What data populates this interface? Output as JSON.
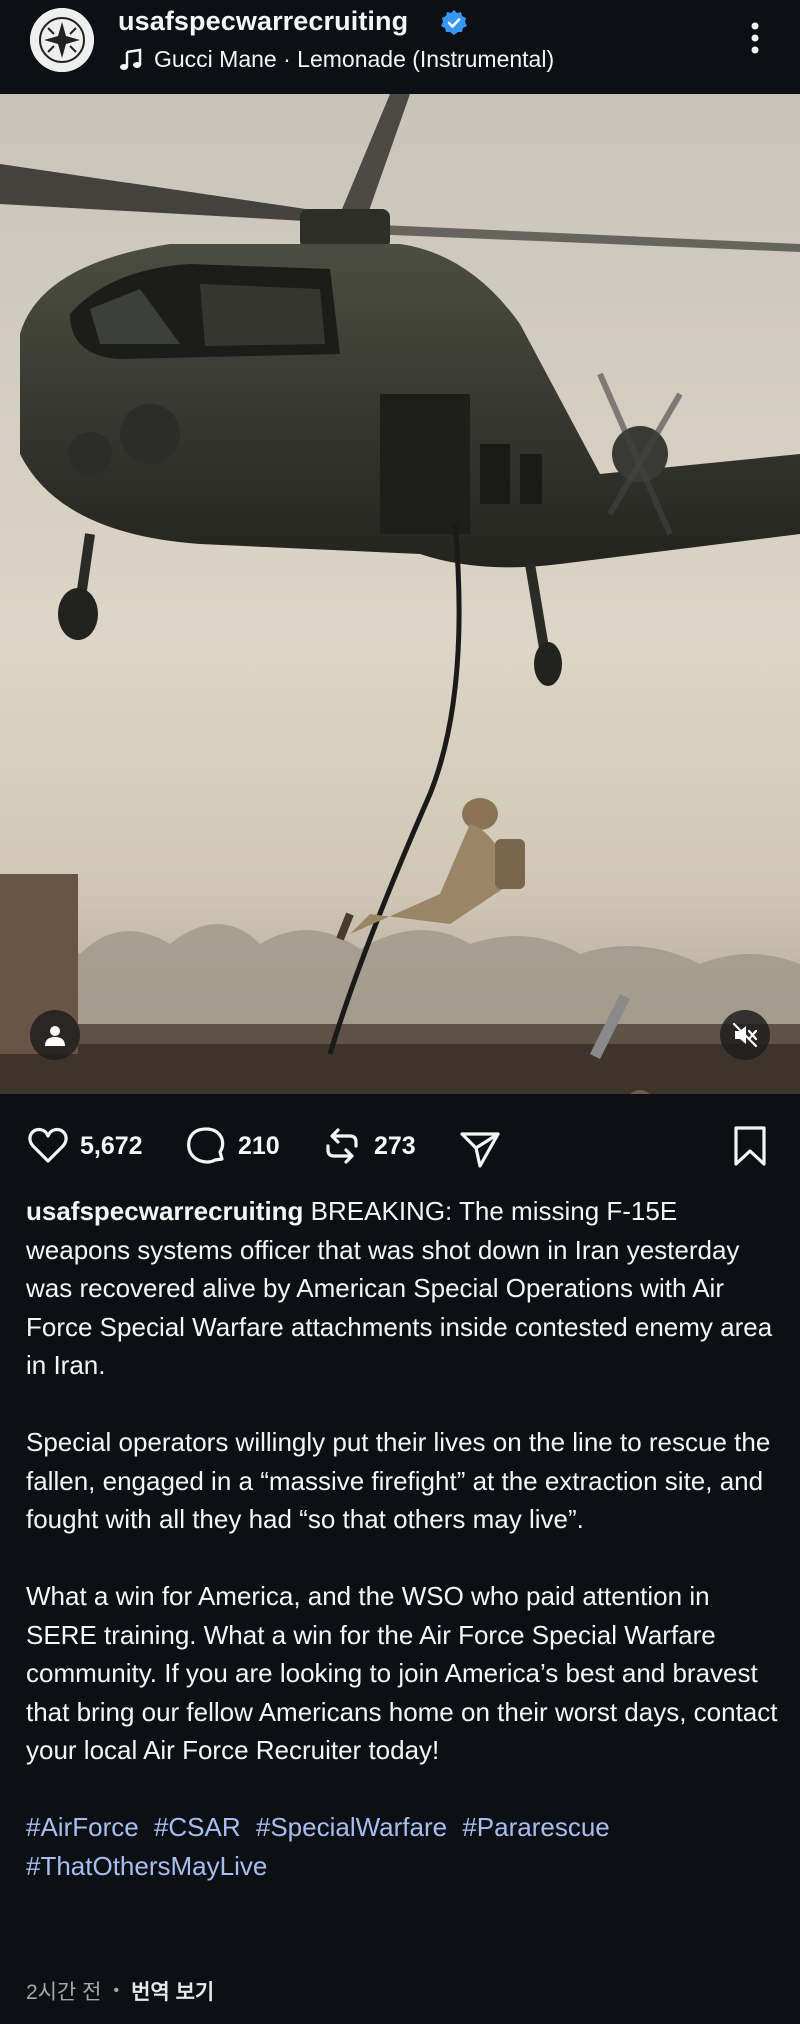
{
  "header": {
    "username": "usafspecwarrecruiting",
    "music": "Gucci Mane · Lemonade (Instrumental)"
  },
  "actions": {
    "likes": "5,672",
    "comments": "210",
    "reposts": "273"
  },
  "caption": {
    "username": "usafspecwarrecruiting",
    "paragraph1": "BREAKING: The missing F-15E weapons systems officer that was shot down in Iran yesterday was recovered alive by American Special Operations with Air Force Special Warfare attachments inside contested enemy area in Iran.",
    "paragraph2": "Special operators willingly put their lives on the line to rescue the fallen, engaged in a “massive firefight” at the extraction site, and fought with all they had “so that others may live”.",
    "paragraph3": "What a win for America, and the WSO who paid attention in SERE training. What a win for the Air Force Special Warfare community. If you are looking to join America’s best and bravest that bring our fellow Americans home on their worst days, contact your local Air Force Recruiter today!",
    "hashtags": [
      "#AirForce",
      "#CSAR",
      "#SpecialWarfare",
      "#Pararescue",
      "#ThatOthersMayLive"
    ]
  },
  "meta": {
    "time": "2시간 전",
    "separator": "•",
    "translate": "번역 보기"
  },
  "colors": {
    "background": "#0c1014",
    "text": "#f5f5f5",
    "hashtag": "#a8bdf0",
    "verified": "#3897f0",
    "muted": "#a8a8a8"
  },
  "icons": [
    "more-options-icon",
    "verified-badge-icon",
    "music-note-icon",
    "user-tag-icon",
    "mute-icon",
    "heart-icon",
    "comment-icon",
    "repost-icon",
    "share-icon",
    "bookmark-icon"
  ]
}
